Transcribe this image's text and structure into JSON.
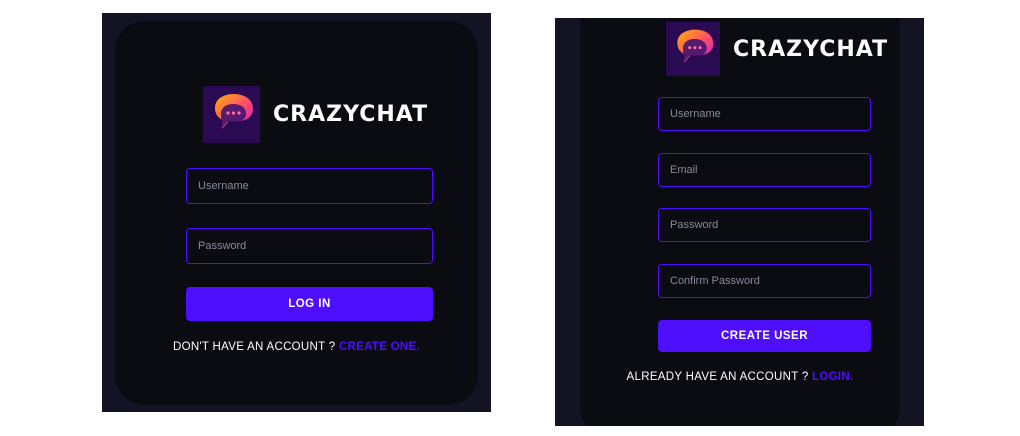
{
  "brand": {
    "name": "CRAZYCHAT"
  },
  "login": {
    "username_placeholder": "Username",
    "password_placeholder": "Password",
    "submit_label": "LOG IN",
    "footer_text": "DON'T HAVE AN ACCOUNT ? ",
    "footer_link": "CREATE ONE."
  },
  "register": {
    "username_placeholder": "Username",
    "email_placeholder": "Email",
    "password_placeholder": "Password",
    "confirm_placeholder": "Confirm Password",
    "submit_label": "CREATE USER",
    "footer_text": "ALREADY HAVE AN ACCOUNT ? ",
    "footer_link": "LOGIN."
  },
  "colors": {
    "accent": "#4e0eff",
    "card_background": "#0b0b12",
    "page_background": "#131324",
    "text": "#ffffff"
  },
  "icons": {
    "logo": "chat-bubble-logo-icon"
  }
}
